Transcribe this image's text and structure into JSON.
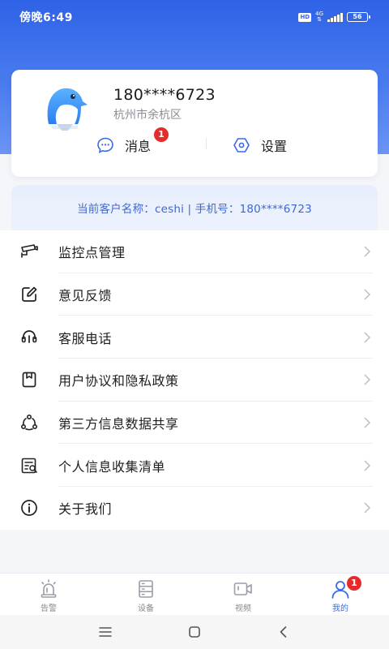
{
  "status_bar": {
    "time": "傍晚6:49",
    "hd": "HD",
    "network": "4G",
    "battery": "56"
  },
  "profile": {
    "phone": "180****6723",
    "location": "杭州市余杭区",
    "avatar_icon": "penguin-avatar-icon"
  },
  "actions": {
    "messages_label": "消息",
    "messages_badge": "1",
    "settings_label": "设置"
  },
  "customer": {
    "info_text": "当前客户名称：ceshi | 手机号：180****6723"
  },
  "menu": [
    {
      "label": "监控点管理",
      "icon": "camera-icon"
    },
    {
      "label": "意见反馈",
      "icon": "edit-icon"
    },
    {
      "label": "客服电话",
      "icon": "headset-icon"
    },
    {
      "label": "用户协议和隐私政策",
      "icon": "document-icon"
    },
    {
      "label": "第三方信息数据共享",
      "icon": "share-icon"
    },
    {
      "label": "个人信息收集清单",
      "icon": "list-icon"
    },
    {
      "label": "关于我们",
      "icon": "info-icon"
    }
  ],
  "bottom_nav": [
    {
      "label": "告警",
      "icon": "alarm-icon"
    },
    {
      "label": "设备",
      "icon": "device-icon"
    },
    {
      "label": "视频",
      "icon": "video-icon"
    },
    {
      "label": "我的",
      "icon": "user-icon",
      "badge": "1"
    }
  ],
  "colors": {
    "accent": "#3a6ae9",
    "badge": "#e52b2b",
    "header_top": "#2f62e6"
  }
}
